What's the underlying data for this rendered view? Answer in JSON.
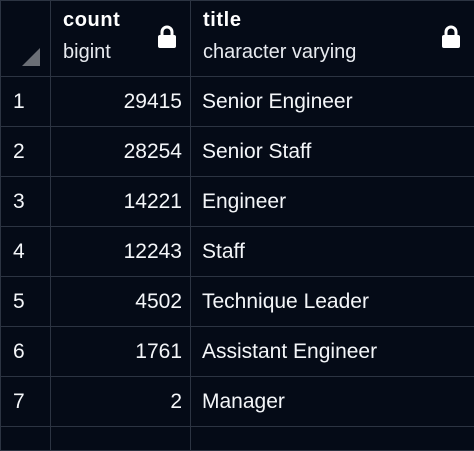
{
  "columns": {
    "count": {
      "name": "count",
      "type": "bigint",
      "icon": "lock-icon"
    },
    "title": {
      "name": "title",
      "type": "character varying",
      "icon": "lock-icon"
    }
  },
  "rows": [
    {
      "num": "1",
      "count": "29415",
      "title": "Senior Engineer"
    },
    {
      "num": "2",
      "count": "28254",
      "title": "Senior Staff"
    },
    {
      "num": "3",
      "count": "14221",
      "title": "Engineer"
    },
    {
      "num": "4",
      "count": "12243",
      "title": "Staff"
    },
    {
      "num": "5",
      "count": "4502",
      "title": "Technique Leader"
    },
    {
      "num": "6",
      "count": "1761",
      "title": "Assistant Engineer"
    },
    {
      "num": "7",
      "count": "2",
      "title": "Manager"
    }
  ],
  "colors": {
    "background": "#050b17",
    "grid_line": "#2c3442",
    "text": "#ffffff"
  }
}
